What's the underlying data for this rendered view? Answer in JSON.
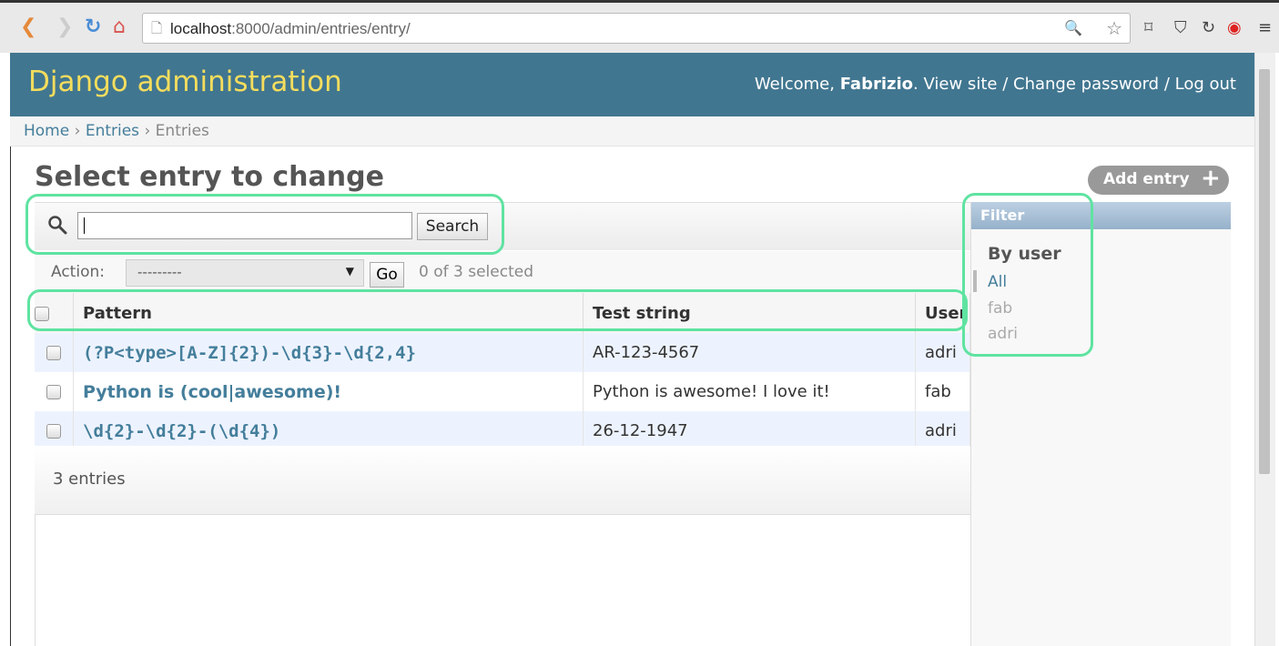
{
  "browser": {
    "url_host": "localhost",
    "url_rest": ":8000/admin/entries/entry/"
  },
  "header": {
    "site_name": "Django administration",
    "welcome": "Welcome,",
    "username": "Fabrizio",
    "view_site": "View site",
    "change_password": "Change password",
    "logout": "Log out",
    "sep": "/"
  },
  "breadcrumbs": {
    "home": "Home",
    "app": "Entries",
    "model": "Entries",
    "sep": "›"
  },
  "content": {
    "title": "Select entry to change",
    "add_button": "Add entry"
  },
  "search": {
    "value": "",
    "button": "Search"
  },
  "actions": {
    "label": "Action:",
    "selected": "---------",
    "go": "Go",
    "counter": "0 of 3 selected"
  },
  "table": {
    "headers": [
      "Pattern",
      "Test string",
      "User"
    ],
    "rows": [
      {
        "pattern": "(?P<type>[A-Z]{2})-\\d{3}-\\d{2,4}",
        "test_string": "AR-123-4567",
        "user": "adri"
      },
      {
        "pattern": "Python is (cool|awesome)!",
        "test_string": "Python is awesome! I love it!",
        "user": "fab"
      },
      {
        "pattern": "\\d{2}-\\d{2}-(\\d{4})",
        "test_string": "26-12-1947",
        "user": "adri"
      }
    ]
  },
  "paginator": {
    "text": "3 entries"
  },
  "filter": {
    "title": "Filter",
    "subtitle": "By user",
    "items": [
      "All",
      "fab",
      "adri"
    ]
  },
  "colors": {
    "header_bg": "#417690",
    "site_name": "#f5dd5d",
    "link": "#447e9b",
    "highlight": "#5fe3a1"
  },
  "icons": [
    "back-icon",
    "forward-icon",
    "reload-icon",
    "home-icon",
    "page-icon",
    "zoom-icon",
    "star-icon",
    "pocket-icon",
    "opera-icon",
    "menu-icon",
    "search-icon",
    "plus-icon"
  ]
}
